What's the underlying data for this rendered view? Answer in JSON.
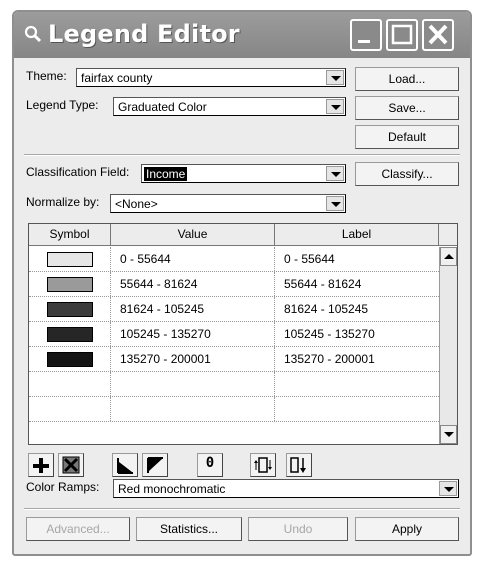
{
  "window": {
    "title": "Legend Editor"
  },
  "form": {
    "theme_label": "Theme:",
    "theme_value": "fairfax county",
    "legend_type_label": "Legend Type:",
    "legend_type_value": "Graduated Color",
    "classification_label": "Classification Field:",
    "classification_value": "Income",
    "normalize_label": "Normalize by:",
    "normalize_value": "<None>",
    "color_ramps_label": "Color Ramps:",
    "color_ramps_value": "Red monochromatic"
  },
  "buttons": {
    "load": "Load...",
    "save": "Save...",
    "default": "Default",
    "classify": "Classify...",
    "advanced": "Advanced...",
    "statistics": "Statistics...",
    "undo": "Undo",
    "apply": "Apply"
  },
  "table": {
    "headers": [
      "Symbol",
      "Value",
      "Label"
    ],
    "rows": [
      {
        "value": "0 - 55644",
        "label": "0 - 55644",
        "color": "#e6e6e6"
      },
      {
        "value": "55644 - 81624",
        "label": "55644 - 81624",
        "color": "#9a9a9a"
      },
      {
        "value": "81624 - 105245",
        "label": "81624 - 105245",
        "color": "#3c3c3c"
      },
      {
        "value": "105245 - 135270",
        "label": "105245 - 135270",
        "color": "#262626"
      },
      {
        "value": "135270 - 200001",
        "label": "135270 - 200001",
        "color": "#141414"
      }
    ]
  },
  "toolbar": {
    "icons": [
      "add-class-icon",
      "delete-class-icon",
      "ramp-ascending-icon",
      "ramp-descending-icon",
      "zero-icon",
      "reverse-icon",
      "sort-icon"
    ],
    "zero_glyph": "0"
  }
}
